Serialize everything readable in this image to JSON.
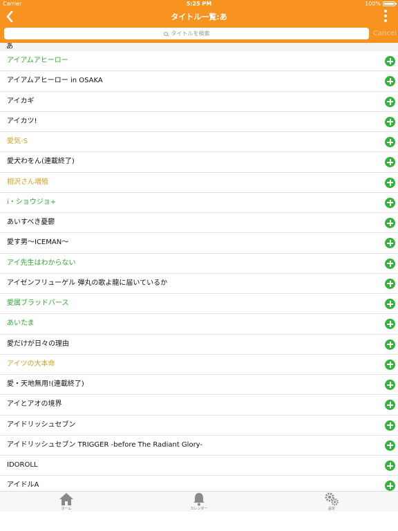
{
  "status_bar": {
    "carrier": "Carrier",
    "time": "5:25 PM",
    "battery": "100%"
  },
  "nav": {
    "title": "タイトル一覧:あ",
    "back_icon": "chevron-left-icon",
    "menu_icon": "vertical-dots-icon"
  },
  "search": {
    "placeholder": "タイトルを検索",
    "cancel_label": "Cancel"
  },
  "section": {
    "header": "あ"
  },
  "titles": [
    {
      "label": "アイアムアヒーロー",
      "color": "#2eaa2e"
    },
    {
      "label": "アイアムアヒーロー in OSAKA",
      "color": "#111111"
    },
    {
      "label": "アイカギ",
      "color": "#111111"
    },
    {
      "label": "アイカツ!",
      "color": "#111111"
    },
    {
      "label": "愛気-S",
      "color": "#d6a221"
    },
    {
      "label": "愛犬わをん(連載終了)",
      "color": "#111111"
    },
    {
      "label": "相沢さん増殖",
      "color": "#d6a221"
    },
    {
      "label": "i・ショウジョ+",
      "color": "#2eaa2e"
    },
    {
      "label": "あいすべき憂鬱",
      "color": "#111111"
    },
    {
      "label": "愛す男～ICEMAN～",
      "color": "#111111"
    },
    {
      "label": "アイ先生はわからない",
      "color": "#2eaa2e"
    },
    {
      "label": "アイゼンフリューゲル 弾丸の歌よ龍に届いているか",
      "color": "#111111"
    },
    {
      "label": "愛属ブラッドバース",
      "color": "#2eaa2e"
    },
    {
      "label": "あいたま",
      "color": "#2eaa2e"
    },
    {
      "label": "愛だけが日々の理由",
      "color": "#111111"
    },
    {
      "label": "アイツの大本命",
      "color": "#d6a221"
    },
    {
      "label": "愛・天地無用!(連載終了)",
      "color": "#111111"
    },
    {
      "label": "アイとアオの境界",
      "color": "#111111"
    },
    {
      "label": "アイドリッシュセブン",
      "color": "#111111"
    },
    {
      "label": "アイドリッシュセブン TRIGGER -before The Radiant Glory-",
      "color": "#111111"
    },
    {
      "label": "IDOROLL",
      "color": "#111111"
    },
    {
      "label": "アイドルA",
      "color": "#111111"
    }
  ],
  "tabbar": {
    "home_label": "ホーム",
    "calendar_label": "カレンダー",
    "settings_label": "設定"
  },
  "colors": {
    "accent": "#f7931e",
    "add_button": "#35b23b"
  }
}
